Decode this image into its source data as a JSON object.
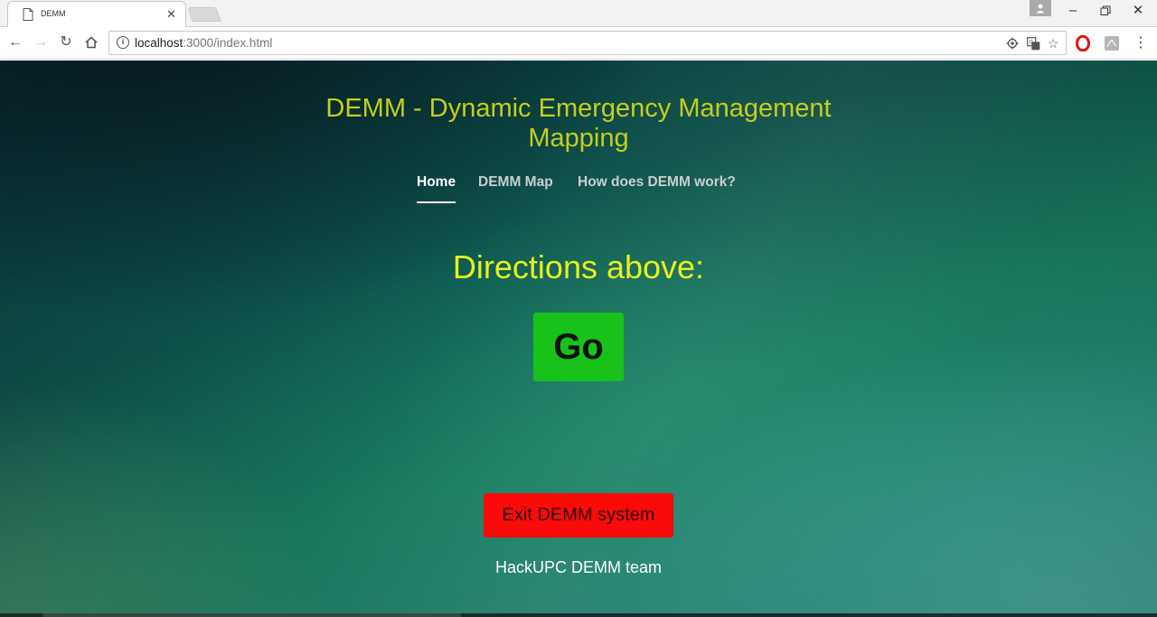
{
  "browser": {
    "tab_title": "DEMM",
    "tab_close": "✕",
    "url_host": "localhost",
    "url_rest": ":3000/index.html",
    "icons": [
      "page-icon",
      "back-icon",
      "forward-icon",
      "reload-icon",
      "home-icon",
      "info-icon",
      "location-icon",
      "translate-icon",
      "star-icon",
      "opera-icon",
      "pdf-icon",
      "menu-icon",
      "profile-icon",
      "minimize-icon",
      "restore-icon",
      "close-icon"
    ]
  },
  "page": {
    "title": "DEMM - Dynamic Emergency Management Mapping",
    "nav": [
      {
        "label": "Home",
        "active": true
      },
      {
        "label": "DEMM Map",
        "active": false
      },
      {
        "label": "How does DEMM work?",
        "active": false
      }
    ],
    "directions_heading": "Directions above:",
    "go_button": "Go",
    "exit_button": "Exit DEMM system",
    "footer": "HackUPC DEMM team",
    "colors": {
      "title": "#c4cf1d",
      "directions": "#e8f21a",
      "go_button": "#19c21a",
      "exit_button": "#fb0a0a"
    }
  }
}
